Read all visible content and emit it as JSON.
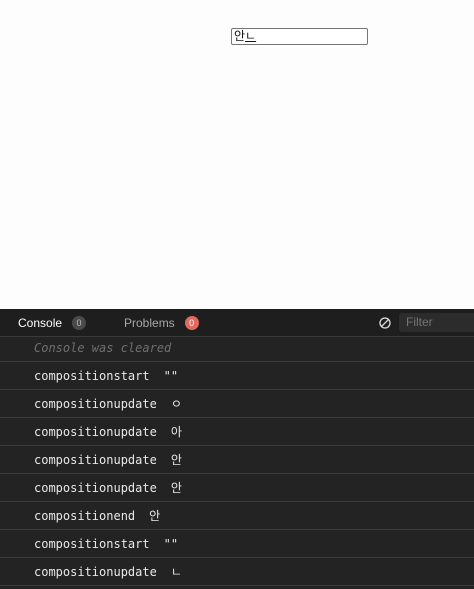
{
  "page": {
    "input_committed": "안",
    "input_composing": "ㄴ"
  },
  "console": {
    "tabs": [
      {
        "label": "Console",
        "count": "0"
      },
      {
        "label": "Problems",
        "count": "0"
      }
    ],
    "filter_placeholder": "Filter",
    "cleared_message": "Console was cleared",
    "logs": [
      {
        "event": "compositionstart",
        "data": "\"\""
      },
      {
        "event": "compositionupdate",
        "data": "ㅇ"
      },
      {
        "event": "compositionupdate",
        "data": "아"
      },
      {
        "event": "compositionupdate",
        "data": "안"
      },
      {
        "event": "compositionupdate",
        "data": "안"
      },
      {
        "event": "compositionend",
        "data": "안"
      },
      {
        "event": "compositionstart",
        "data": "\"\""
      },
      {
        "event": "compositionupdate",
        "data": "ㄴ"
      }
    ]
  },
  "colors": {
    "console_bg": "#232323",
    "problems_badge": "#e06a5e"
  }
}
